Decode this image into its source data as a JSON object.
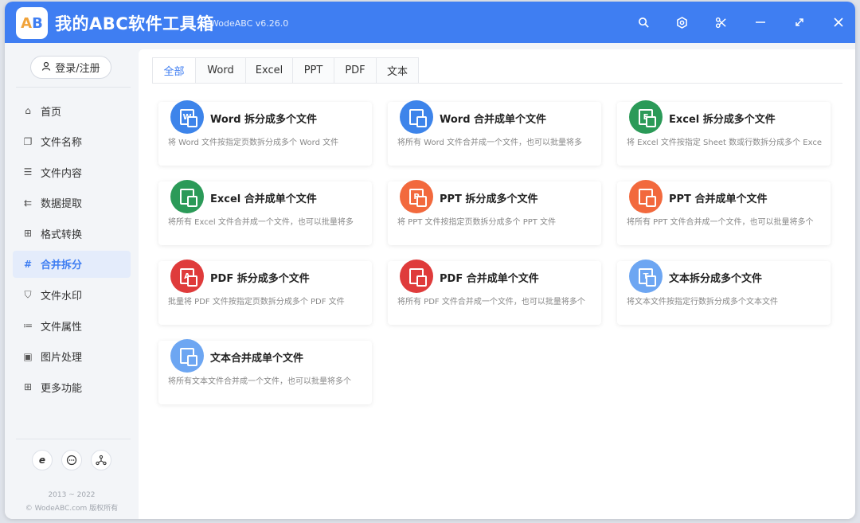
{
  "app": {
    "logo_a": "A",
    "logo_b": "B",
    "title": "我的ABC软件工具箱",
    "version": "WodeABC v6.26.0"
  },
  "titlebar_icons": [
    "search-icon",
    "gear-icon",
    "scissors-icon",
    "minimize-icon",
    "maximize-icon",
    "close-icon"
  ],
  "sidebar": {
    "login_label": "登录/注册",
    "items": [
      {
        "label": "首页",
        "icon": "home-icon"
      },
      {
        "label": "文件名称",
        "icon": "file-name-icon"
      },
      {
        "label": "文件内容",
        "icon": "file-content-icon"
      },
      {
        "label": "数据提取",
        "icon": "data-extract-icon"
      },
      {
        "label": "格式转换",
        "icon": "format-convert-icon"
      },
      {
        "label": "合并拆分",
        "icon": "merge-split-icon"
      },
      {
        "label": "文件水印",
        "icon": "watermark-icon"
      },
      {
        "label": "文件属性",
        "icon": "file-property-icon"
      },
      {
        "label": "图片处理",
        "icon": "image-icon"
      },
      {
        "label": "更多功能",
        "icon": "more-icon"
      }
    ],
    "active_item": "合并拆分",
    "bottom_icons": [
      "ie-icon",
      "chat-icon",
      "network-icon"
    ],
    "copyright_years": "2013 ~ 2022",
    "copyright_text": "© WodeABC.com 版权所有"
  },
  "tabs": [
    "全部",
    "Word",
    "Excel",
    "PPT",
    "PDF",
    "文本"
  ],
  "active_tab": "全部",
  "colors": {
    "accent": "#3f7ef2",
    "word": "#3d84ea",
    "excel": "#2b9a58",
    "ppt": "#f2693d",
    "pdf": "#df3b3b",
    "text": "#6da6f2"
  },
  "cards": [
    {
      "title": "Word 拆分成多个文件",
      "desc": "将 Word 文件按指定页数拆分成多个 Word 文件",
      "icon": "word-split-icon",
      "glyph": "W"
    },
    {
      "title": "Word 合并成单个文件",
      "desc": "将所有 Word 文件合并成一个文件，也可以批量将多",
      "icon": "word-merge-icon",
      "glyph": ""
    },
    {
      "title": "Excel 拆分成多个文件",
      "desc": "将 Excel 文件按指定 Sheet 数或行数拆分成多个 Exce",
      "icon": "excel-split-icon",
      "glyph": "E"
    },
    {
      "title": "Excel 合并成单个文件",
      "desc": "将所有 Excel 文件合并成一个文件，也可以批量将多",
      "icon": "excel-merge-icon",
      "glyph": ""
    },
    {
      "title": "PPT 拆分成多个文件",
      "desc": "将 PPT 文件按指定页数拆分成多个 PPT 文件",
      "icon": "ppt-split-icon",
      "glyph": "P"
    },
    {
      "title": "PPT 合并成单个文件",
      "desc": "将所有 PPT 文件合并成一个文件，也可以批量将多个",
      "icon": "ppt-merge-icon",
      "glyph": ""
    },
    {
      "title": "PDF 拆分成多个文件",
      "desc": "批量将 PDF 文件按指定页数拆分成多个 PDF 文件",
      "icon": "pdf-split-icon",
      "glyph": "A"
    },
    {
      "title": "PDF 合并成单个文件",
      "desc": "将所有 PDF 文件合并成一个文件，也可以批量将多个",
      "icon": "pdf-merge-icon",
      "glyph": ""
    },
    {
      "title": "文本拆分成多个文件",
      "desc": "将文本文件按指定行数拆分成多个文本文件",
      "icon": "text-split-icon",
      "glyph": "T"
    },
    {
      "title": "文本合并成单个文件",
      "desc": "将所有文本文件合并成一个文件，也可以批量将多个",
      "icon": "text-merge-icon",
      "glyph": ""
    }
  ]
}
